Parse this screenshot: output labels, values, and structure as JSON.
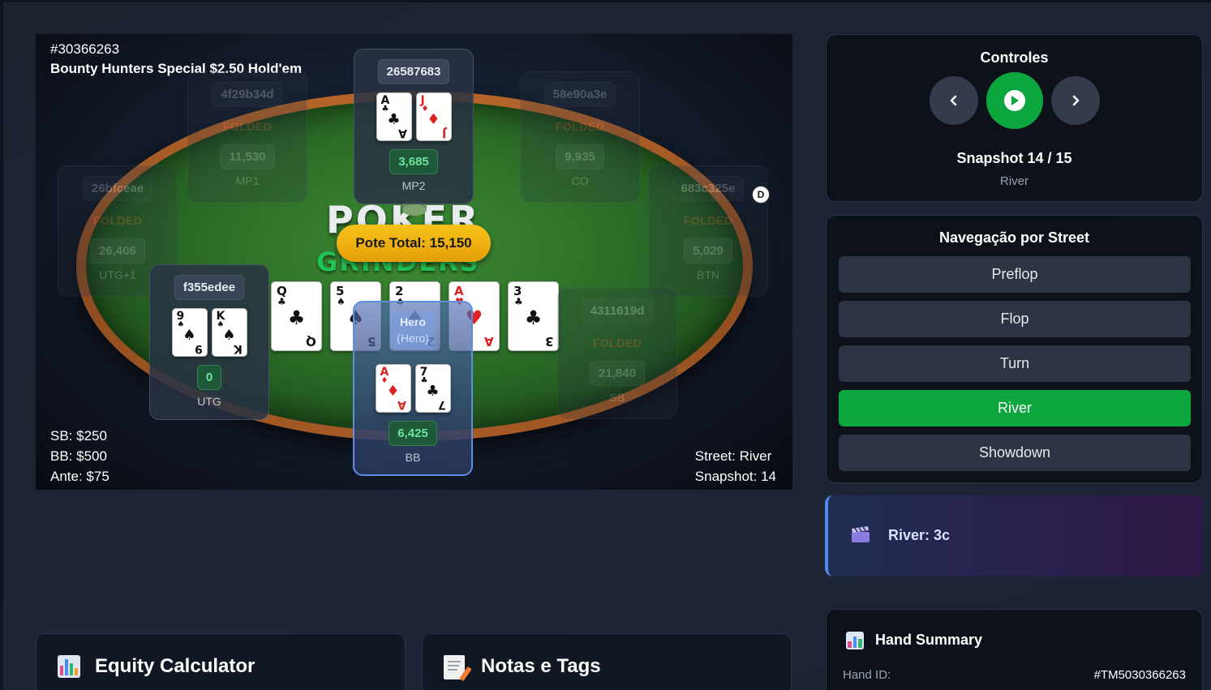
{
  "table": {
    "hand_id": "#30366263",
    "hand_name": "Bounty Hunters Special $2.50 Hold'em",
    "logo_top": "POKER",
    "logo_bottom": "GRINDERS",
    "pot": "Pote Total: 15,150",
    "blinds": {
      "sb": "SB: $250",
      "bb": "BB: $500",
      "ante": "Ante: $75"
    },
    "street": "Street: River",
    "snapshot": "Snapshot: 14",
    "dealer": "D",
    "board": [
      {
        "rank": "Q",
        "suit": "♣",
        "red": false
      },
      {
        "rank": "5",
        "suit": "♠",
        "red": false
      },
      {
        "rank": "2",
        "suit": "♠",
        "red": false
      },
      {
        "rank": "A",
        "suit": "♥",
        "red": true
      },
      {
        "rank": "3",
        "suit": "♣",
        "red": false
      }
    ],
    "seats": {
      "mp1": {
        "name": "4f29b34d",
        "status": "FOLDED",
        "stack": "11,530",
        "pos": "MP1"
      },
      "mp2": {
        "name": "26587683",
        "stack": "3,685",
        "pos": "MP2",
        "cards": [
          {
            "rank": "A",
            "suit": "♣",
            "red": false
          },
          {
            "rank": "J",
            "suit": "♦",
            "red": true
          }
        ]
      },
      "co": {
        "name": "58e90a3e",
        "status": "FOLDED",
        "stack": "9,935",
        "pos": "CO"
      },
      "utg1": {
        "name": "26bfceae",
        "status": "FOLDED",
        "stack": "26,406",
        "pos": "UTG+1"
      },
      "btn": {
        "name": "683c325e",
        "status": "FOLDED",
        "stack": "5,029",
        "pos": "BTN"
      },
      "utg": {
        "name": "f355edee",
        "stack": "0",
        "pos": "UTG",
        "cards": [
          {
            "rank": "9",
            "suit": "♠",
            "red": false
          },
          {
            "rank": "K",
            "suit": "♠",
            "red": false
          }
        ]
      },
      "sb": {
        "name": "4311619d",
        "status": "FOLDED",
        "stack": "21,840",
        "pos": "SB"
      },
      "bb": {
        "name": "Hero",
        "sub": "(Hero)",
        "stack": "6,425",
        "pos": "BB",
        "cards": [
          {
            "rank": "A",
            "suit": "♦",
            "red": true
          },
          {
            "rank": "7",
            "suit": "♣",
            "red": false
          }
        ]
      }
    }
  },
  "controls": {
    "title": "Controles",
    "prev_icon": "chevron-left-icon",
    "play_icon": "play-icon",
    "next_icon": "chevron-right-icon",
    "snapshot": "Snapshot 14 / 15",
    "street": "River"
  },
  "streets": {
    "title": "Navegação por Street",
    "items": [
      "Preflop",
      "Flop",
      "Turn",
      "River",
      "Showdown"
    ],
    "active": "River"
  },
  "event": {
    "icon": "clapperboard-icon",
    "text": "River: 3c"
  },
  "summary": {
    "title": "Hand Summary",
    "icon": "bar-chart-icon",
    "label": "Hand ID:",
    "value": "#TM5030366263"
  },
  "equity": {
    "title": "Equity Calculator",
    "icon": "bar-chart-icon"
  },
  "notes": {
    "title": "Notas e Tags",
    "icon": "memo-icon"
  },
  "colors": {
    "accent": "#0ca63e",
    "pot": "#f7c21a",
    "hero": "#5f8ee0"
  }
}
